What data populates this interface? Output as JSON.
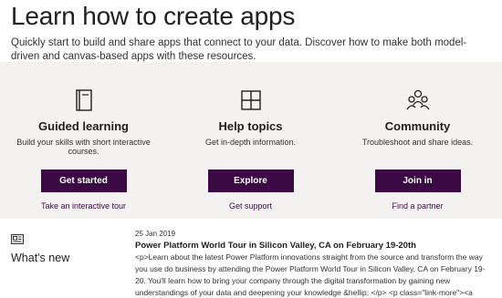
{
  "hero": {
    "title": "Learn how to create apps",
    "subtitle": "Quickly start to build and share apps that connect to your data. Discover how to make both model-driven and canvas-based apps with these resources."
  },
  "resources": [
    {
      "icon": "book-icon",
      "title": "Guided learning",
      "description": "Build your skills with short interactive courses.",
      "button": "Get started",
      "link": "Take an interactive tour"
    },
    {
      "icon": "grid-icon",
      "title": "Help topics",
      "description": "Get in-depth information.",
      "button": "Explore",
      "link": "Get support"
    },
    {
      "icon": "people-icon",
      "title": "Community",
      "description": "Troubleshoot and share ideas.",
      "button": "Join in",
      "link": "Find a partner"
    }
  ],
  "whats_new": {
    "icon": "news-icon",
    "title": "What's new",
    "date": "25 Jan 2019",
    "headline": "Power Platform World Tour in Silicon Valley, CA on February 19-20th",
    "body": "<p>Learn about the latest Power Platform innovations straight from the source and transform the way you use do business by attending the Power Platform World Tour in Silicon Valley, CA on February 19-20. You'll learn how to bring your company through the digital transformation by gaining new understandings of your data and deepening your knowledge &hellip; </p> <p class=\"link-more\"><a"
  },
  "colors": {
    "button_bg": "#3b0a45",
    "panel_bg": "#f3f2f1",
    "link": "#3b0a45"
  }
}
